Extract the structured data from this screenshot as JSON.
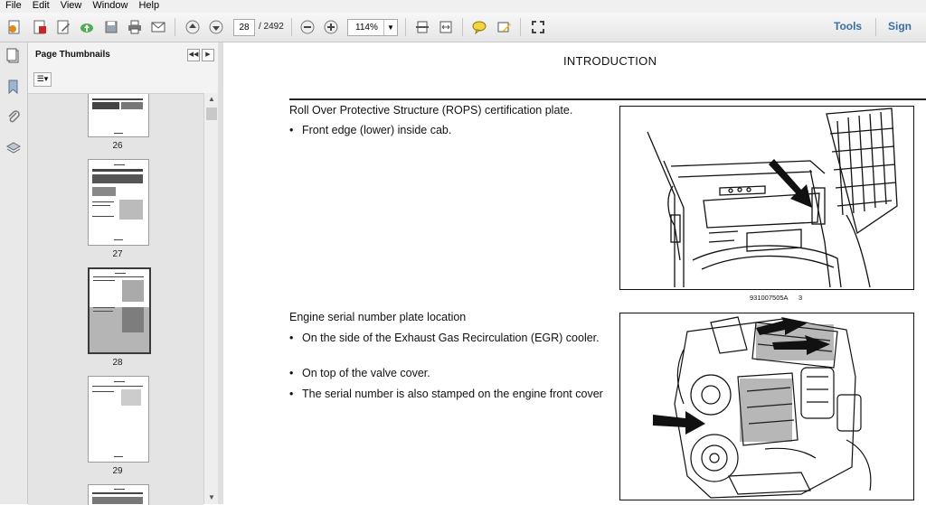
{
  "menu": [
    "File",
    "Edit",
    "View",
    "Window",
    "Help"
  ],
  "toolbar": {
    "current_page": "28",
    "total_pages": "/ 2492",
    "zoom": "114%",
    "tools_label": "Tools",
    "sign_label": "Sign"
  },
  "panel": {
    "title": "Page Thumbnails",
    "thumbnails": [
      {
        "label": "26"
      },
      {
        "label": "27"
      },
      {
        "label": "28",
        "selected": true
      },
      {
        "label": "29"
      }
    ]
  },
  "document": {
    "heading": "INTRODUCTION",
    "section1": {
      "title": "Roll Over Protective Structure (ROPS) certification plate.",
      "bullets": [
        "Front edge (lower) inside cab."
      ],
      "figure_id": "931007505A",
      "figure_num": "3"
    },
    "section2": {
      "title": "Engine serial number plate location",
      "bullets": [
        "On the side of the Exhaust Gas Recirculation (EGR) cooler.",
        "On top of the valve cover.",
        "The serial number is also stamped on the engine front cover"
      ]
    }
  }
}
